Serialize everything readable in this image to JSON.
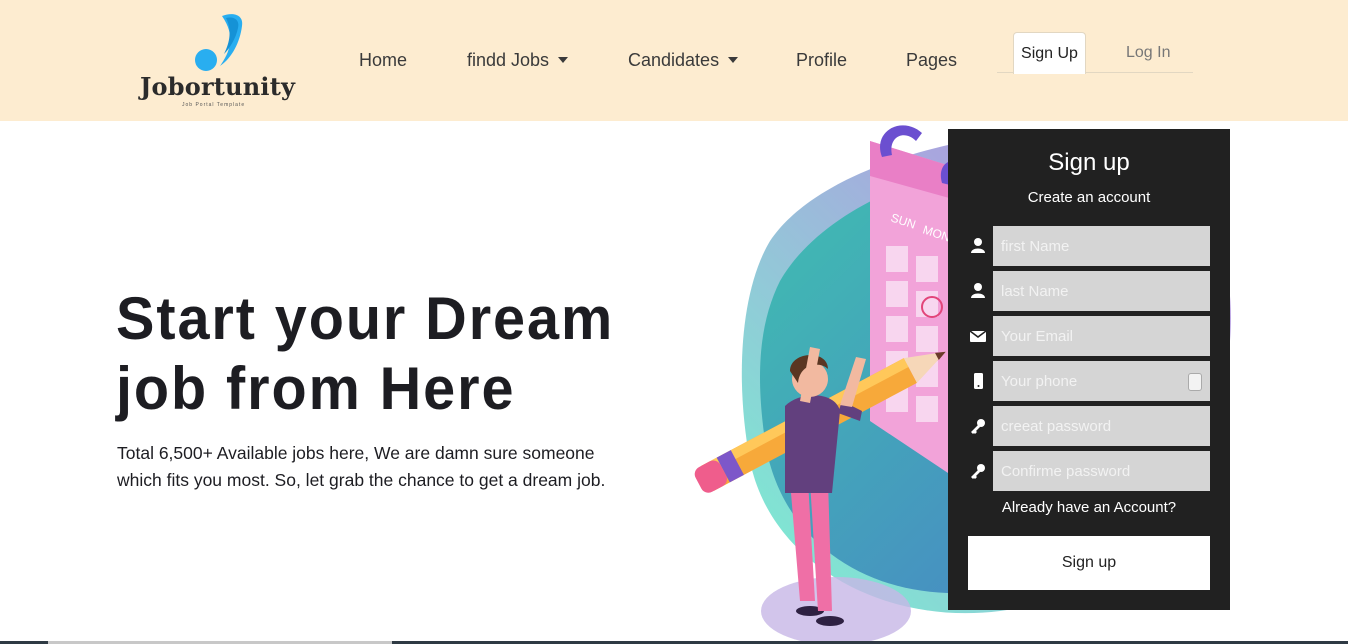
{
  "brand": {
    "name": "Jobortunity",
    "tagline": "Job Portal Template"
  },
  "nav": {
    "items": [
      {
        "label": "Home",
        "dropdown": false
      },
      {
        "label": "findd Jobs",
        "dropdown": true
      },
      {
        "label": "Candidates",
        "dropdown": true
      },
      {
        "label": "Profile",
        "dropdown": false
      },
      {
        "label": "Pages",
        "dropdown": false
      }
    ],
    "tabs": {
      "signup": "Sign Up",
      "login": "Log In",
      "active": "signup"
    }
  },
  "hero": {
    "title_line1": "Start your Dream",
    "title_line2": "job from Here",
    "subtitle_line1": "Total 6,500+ Available jobs here, We are damn sure someone",
    "subtitle_line2": "which fits you most. So, let grab the chance to get a dream job."
  },
  "signup_form": {
    "title": "Sign up",
    "subtitle": "Create an account",
    "fields": [
      {
        "icon": "user-icon",
        "placeholder": "first Name",
        "value": ""
      },
      {
        "icon": "user-icon",
        "placeholder": "last Name",
        "value": ""
      },
      {
        "icon": "envelope-icon",
        "placeholder": "Your Email",
        "value": ""
      },
      {
        "icon": "phone-icon",
        "placeholder": "Your phone",
        "value": ""
      },
      {
        "icon": "key-icon",
        "placeholder": "creeat password",
        "value": ""
      },
      {
        "icon": "key-icon",
        "placeholder": "Confirme password",
        "value": ""
      }
    ],
    "login_link": "Already have an Account?",
    "submit_label": "Sign up"
  },
  "colors": {
    "header_bg": "#fdecd0",
    "panel_bg": "#212121",
    "input_bg": "#d5d5d5",
    "text_dark": "#1d1d22"
  }
}
